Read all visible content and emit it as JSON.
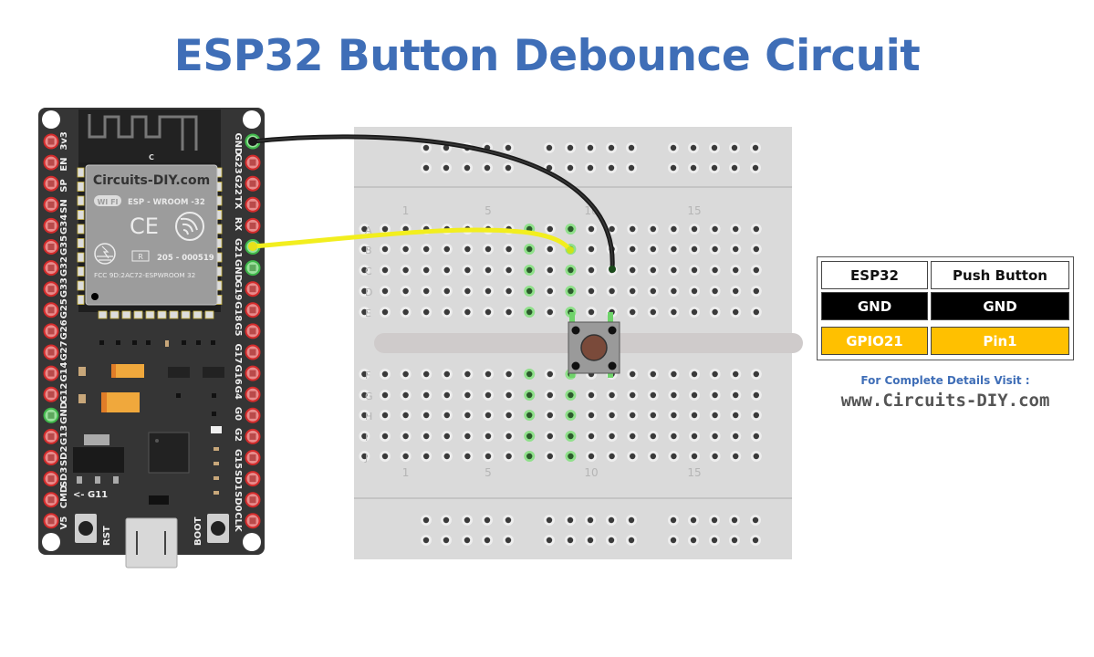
{
  "title": "ESP32 Button Debounce Circuit",
  "esp32_board": {
    "module_brand": "Circuits-DIY.com",
    "module_wifi_badge": "WI FI",
    "module_model": "ESP - WROOM -32",
    "module_ce": "CE",
    "module_r_mark": "R",
    "module_cert": "205 - 000519",
    "module_fcc": "FCC 9D:2AC72-ESPWROOM 32",
    "antenna_label": "C",
    "left_pins": [
      "3v3",
      "EN",
      "SP",
      "SN",
      "G34",
      "G35",
      "G32",
      "G33",
      "G25",
      "G26",
      "G27",
      "G14",
      "G12",
      "GND",
      "G13",
      "SD2",
      "SD3",
      "CMD",
      "V5"
    ],
    "right_pins": [
      "GND",
      "G23",
      "G22",
      "TX",
      "RX",
      "G21",
      "GND",
      "G19",
      "G18",
      "G5",
      "G17",
      "G16",
      "G4",
      "G0",
      "G2",
      "G15",
      "SD1",
      "SD0",
      "CLK"
    ],
    "highlighted_left_pins": [
      "GND"
    ],
    "highlighted_right_pins": [
      "GND",
      "G21",
      "GND"
    ],
    "g11_label": "<- G11",
    "rst_label": "RST",
    "boot_label": "BOOT"
  },
  "breadboard": {
    "row_labels_top": [
      "A",
      "B",
      "C",
      "D",
      "E"
    ],
    "row_labels_bottom": [
      "F",
      "G",
      "H",
      "I",
      "J"
    ],
    "column_numbers": [
      "1",
      "5",
      "10",
      "15"
    ],
    "highlighted_columns": [
      8,
      10
    ]
  },
  "wires": [
    {
      "name": "gnd-wire",
      "from": "ESP32 GND",
      "to": "Breadboard C10",
      "color": "#1a1a1a"
    },
    {
      "name": "gpio21-wire",
      "from": "ESP32 G21",
      "to": "Breadboard B8",
      "color": "#f2ee1e"
    }
  ],
  "push_button": {
    "cap_color": "#7a4a3a",
    "body_color": "#9a9a9a"
  },
  "connection_table": {
    "headers": [
      "ESP32",
      "Push Button"
    ],
    "rows": [
      {
        "esp32": "GND",
        "button": "GND",
        "style": "gnd"
      },
      {
        "esp32": "GPIO21",
        "button": "Pin1",
        "style": "gpio"
      }
    ]
  },
  "footer": {
    "visit_text": "For Complete Details Visit :",
    "website": "www.Circuits-DIY.com"
  },
  "colors": {
    "title_blue": "#3f6eb7",
    "gpio_yellow": "#ffc000",
    "pin_red": "#d42b2b",
    "pin_green": "#3fb84a",
    "board": "#333333",
    "breadboard": "#d9d9d9"
  }
}
